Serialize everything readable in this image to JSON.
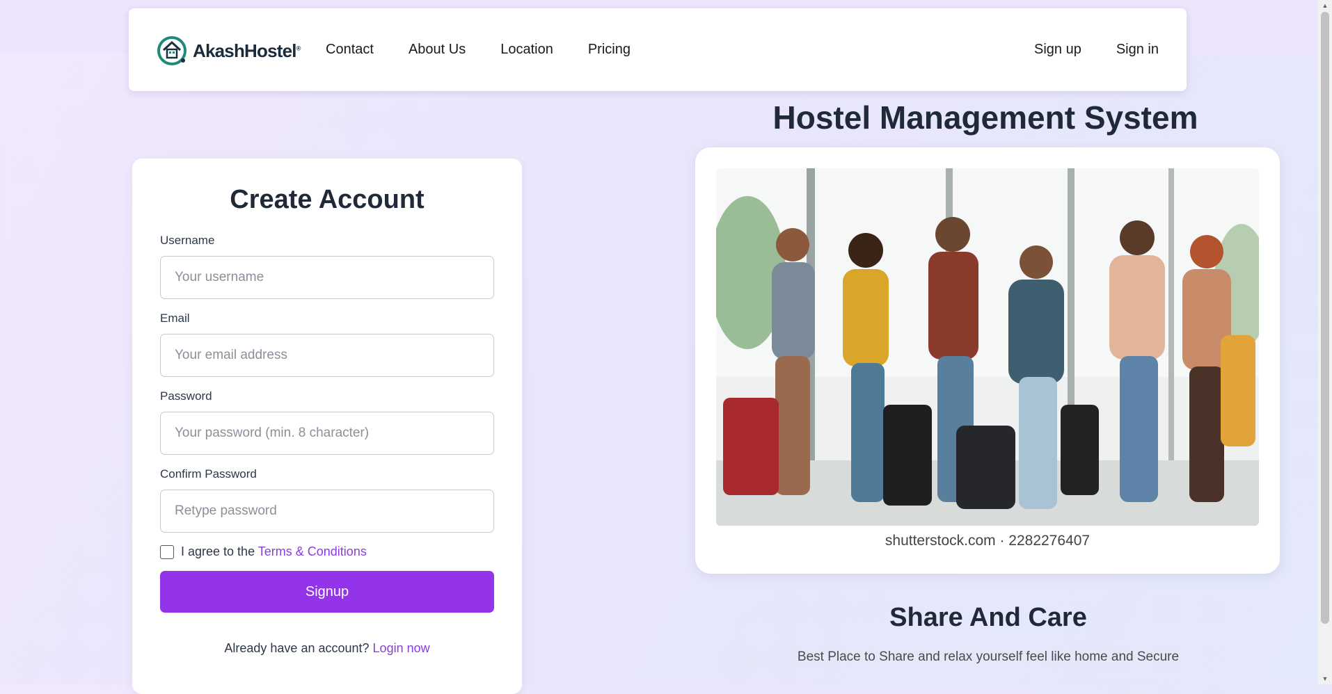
{
  "nav": {
    "logo_text": "AkashHostel",
    "logo_mark": "®",
    "links": [
      "Contact",
      "About Us",
      "Location",
      "Pricing"
    ],
    "signup": "Sign up",
    "signin": "Sign in"
  },
  "page_title": "Hostel Management System",
  "form": {
    "title": "Create Account",
    "username_label": "Username",
    "username_placeholder": "Your username",
    "email_label": "Email",
    "email_placeholder": "Your email address",
    "password_label": "Password",
    "password_placeholder": "Your password (min. 8 character)",
    "confirm_label": "Confirm Password",
    "confirm_placeholder": "Retype password",
    "agree_text": "I agree to the",
    "terms_link": "Terms & Conditions",
    "submit": "Signup",
    "login_prompt": "Already have an account?",
    "login_link": "Login now"
  },
  "hero": {
    "image_credit": "shutterstock.com · 2282276407",
    "tagline": "Share And Care",
    "subtagline": "Best Place to Share and relax yourself feel like home and Secure"
  },
  "colors": {
    "accent": "#9333ea",
    "link": "#8a3ce0",
    "logo_teal": "#1f8a7a"
  }
}
